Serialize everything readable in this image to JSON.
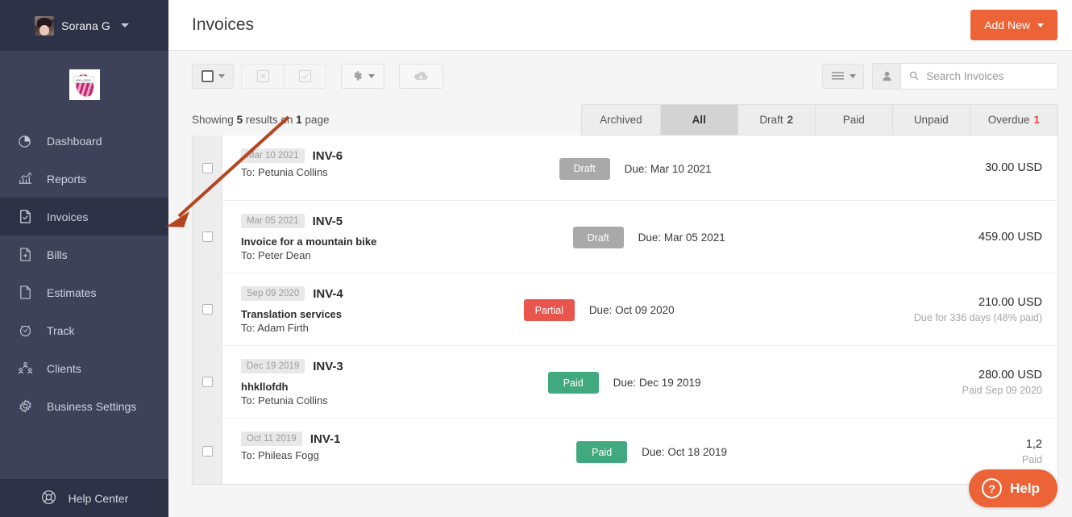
{
  "sidebar": {
    "user": {
      "name": "Sorana G",
      "avatar_icon": "user-avatar",
      "caret_icon": "chevron-down-icon"
    },
    "logo_text": "MY LOGO",
    "items": [
      {
        "label": "Dashboard",
        "icon": "pie-chart-icon",
        "active": false
      },
      {
        "label": "Reports",
        "icon": "bar-chart-icon",
        "active": false
      },
      {
        "label": "Invoices",
        "icon": "document-check-icon",
        "active": true
      },
      {
        "label": "Bills",
        "icon": "document-plus-icon",
        "active": false
      },
      {
        "label": "Estimates",
        "icon": "document-icon",
        "active": false
      },
      {
        "label": "Track",
        "icon": "clock-icon",
        "active": false
      },
      {
        "label": "Clients",
        "icon": "users-icon",
        "active": false
      },
      {
        "label": "Business Settings",
        "icon": "gear-icon",
        "active": false
      }
    ],
    "help_center": {
      "label": "Help Center",
      "icon": "lifebuoy-icon"
    }
  },
  "header": {
    "title": "Invoices",
    "add_new": {
      "label": "Add New",
      "caret_icon": "chevron-down-icon",
      "color": "#ec6338"
    }
  },
  "toolbar": {
    "select_all": {
      "icon": "checkbox-icon",
      "caret_icon": "chevron-down-icon"
    },
    "delete": {
      "icon": "x-square-icon",
      "disabled": true
    },
    "approve": {
      "icon": "check-square-icon",
      "disabled": true
    },
    "settings": {
      "icon": "gear-icon",
      "caret_icon": "chevron-down-icon"
    },
    "download": {
      "icon": "cloud-download-icon"
    },
    "view_menu": {
      "icon": "list-lines-icon",
      "caret_icon": "chevron-down-icon"
    },
    "client_filter": {
      "icon": "person-icon"
    },
    "search": {
      "placeholder": "Search Invoices",
      "value": "",
      "icon": "search-icon"
    }
  },
  "list": {
    "showing_prefix": "Showing",
    "results_count": "5",
    "showing_middle": "results on",
    "page_count": "1",
    "showing_suffix": "page",
    "tabs": [
      {
        "label": "Archived",
        "count": "",
        "active": false,
        "warn": false
      },
      {
        "label": "All",
        "count": "",
        "active": true,
        "warn": false
      },
      {
        "label": "Draft",
        "count": "2",
        "active": false,
        "warn": false
      },
      {
        "label": "Paid",
        "count": "",
        "active": false,
        "warn": false
      },
      {
        "label": "Unpaid",
        "count": "",
        "active": false,
        "warn": false
      },
      {
        "label": "Overdue",
        "count": "1",
        "active": false,
        "warn": true
      }
    ],
    "rows": [
      {
        "date": "Mar 10 2021",
        "number": "INV-6",
        "subject": "",
        "to": "To: Petunia Collins",
        "status": "Draft",
        "status_kind": "draft",
        "due": "Due: Mar 10 2021",
        "amount": "30.00 USD",
        "submeta": ""
      },
      {
        "date": "Mar 05 2021",
        "number": "INV-5",
        "subject": "Invoice for a mountain bike",
        "to": "To: Peter Dean",
        "status": "Draft",
        "status_kind": "draft",
        "due": "Due: Mar 05 2021",
        "amount": "459.00 USD",
        "submeta": ""
      },
      {
        "date": "Sep 09 2020",
        "number": "INV-4",
        "subject": "Translation services",
        "to": "To: Adam Firth",
        "status": "Partial",
        "status_kind": "partial",
        "due": "Due: Oct 09 2020",
        "amount": "210.00 USD",
        "submeta": "Due for 336 days (48% paid)"
      },
      {
        "date": "Dec 19 2019",
        "number": "INV-3",
        "subject": "hhkllofdh",
        "to": "To: Petunia Collins",
        "status": "Paid",
        "status_kind": "paid",
        "due": "Due: Dec 19 2019",
        "amount": "280.00 USD",
        "submeta": "Paid Sep 09 2020"
      },
      {
        "date": "Oct 11 2019",
        "number": "INV-1",
        "subject": "",
        "to": "To: Phileas Fogg",
        "status": "Paid",
        "status_kind": "paid",
        "due": "Due: Oct 18 2019",
        "amount": "1,2",
        "submeta": "Paid"
      }
    ]
  },
  "help_widget": {
    "label": "Help",
    "icon": "question-mark-icon",
    "color": "#ec6338"
  },
  "annotation": {
    "arrow_color": "#b4451f",
    "type": "pointer-arrow"
  }
}
